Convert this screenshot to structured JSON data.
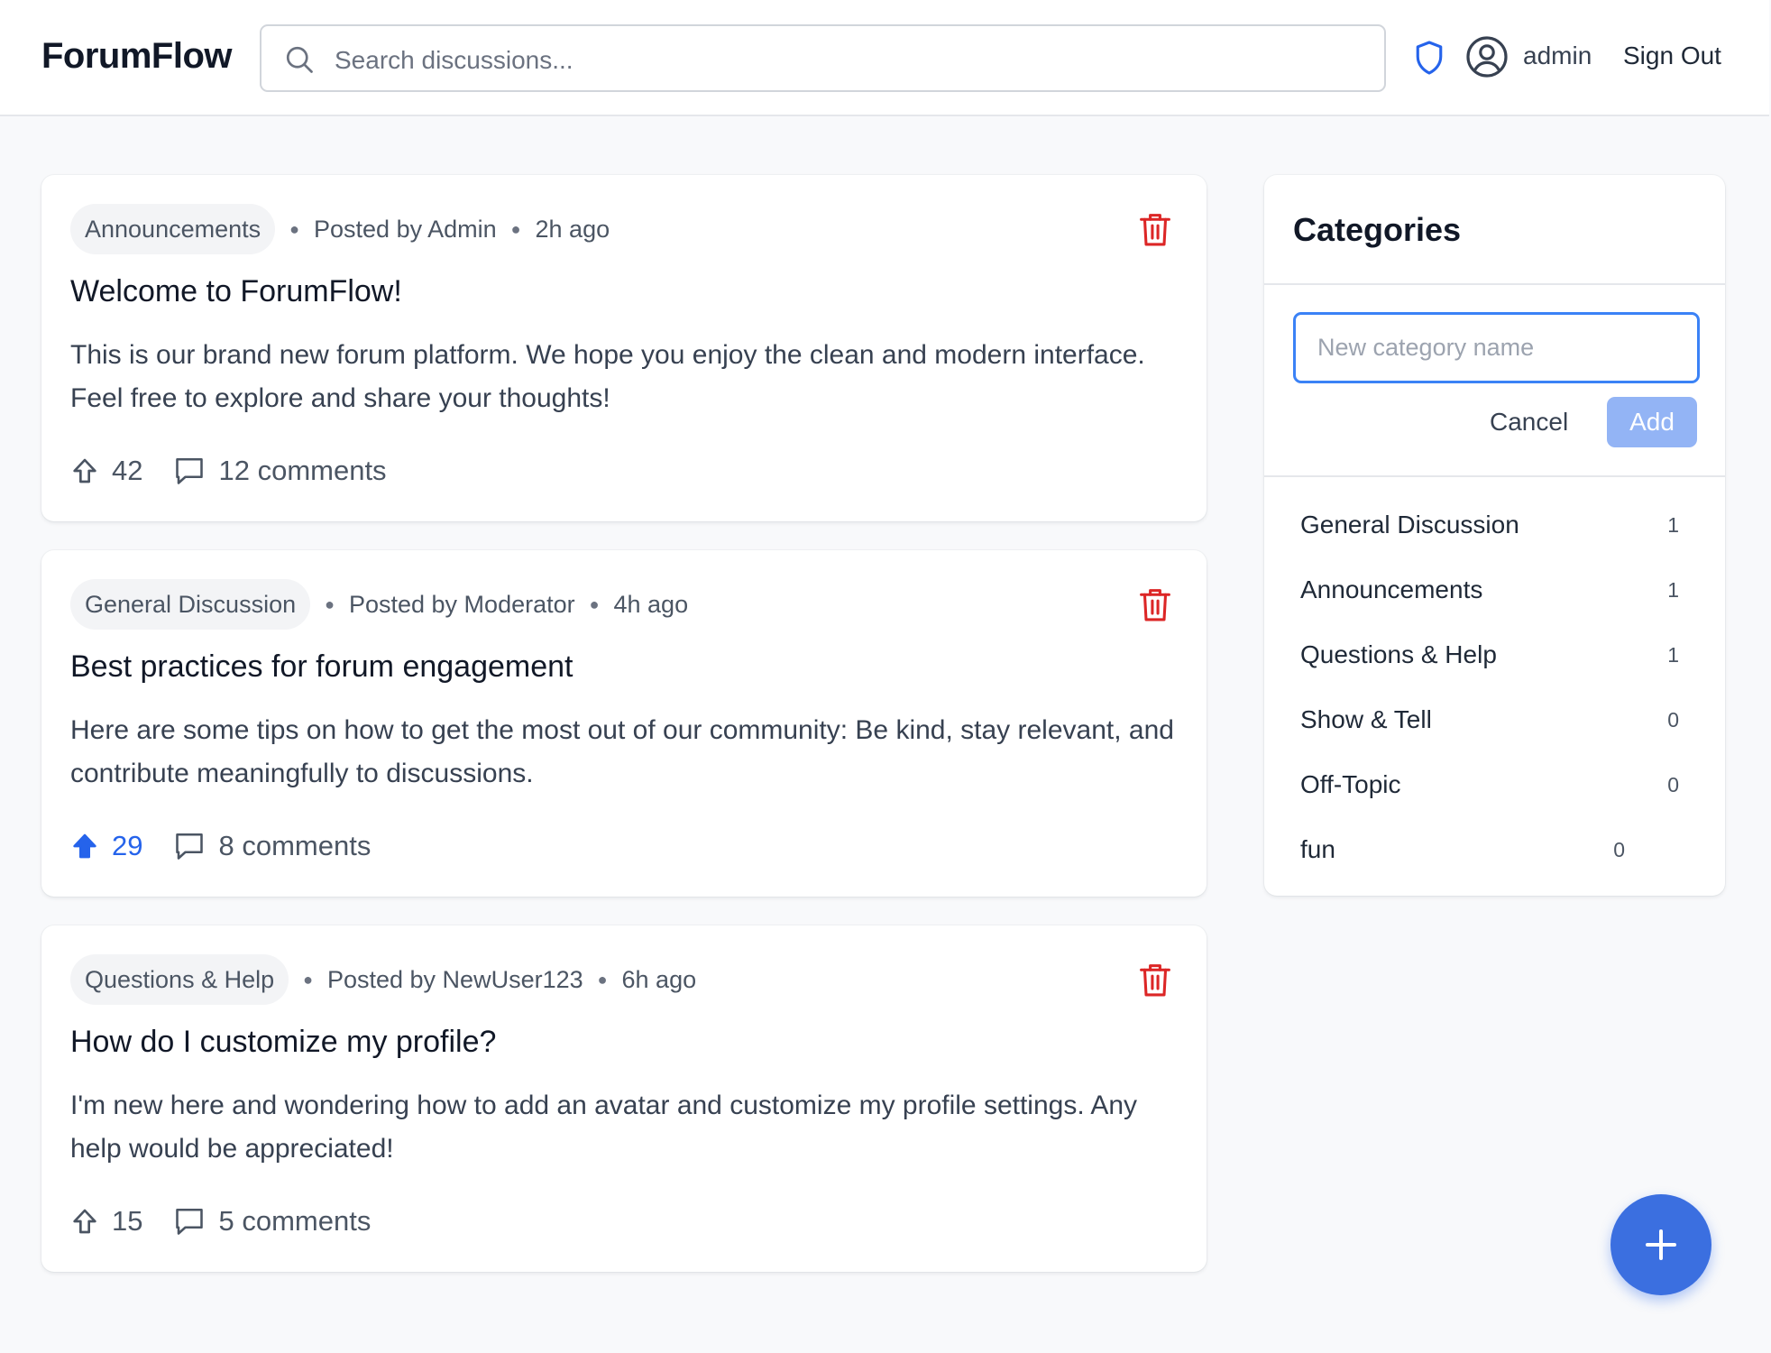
{
  "header": {
    "brand": "ForumFlow",
    "search_placeholder": "Search discussions...",
    "username": "admin",
    "sign_out": "Sign Out",
    "icons": [
      "search-icon",
      "shield-icon",
      "user-circle-icon"
    ]
  },
  "posts": [
    {
      "category": "Announcements",
      "author_text": "Posted by Admin",
      "time": "2h ago",
      "title": "Welcome to ForumFlow!",
      "body": "This is our brand new forum platform. We hope you enjoy the clean and modern interface. Feel free to explore and share your thoughts!",
      "votes": "42",
      "voted": false,
      "comments": "12 comments"
    },
    {
      "category": "General Discussion",
      "author_text": "Posted by Moderator",
      "time": "4h ago",
      "title": "Best practices for forum engagement",
      "body": "Here are some tips on how to get the most out of our community: Be kind, stay relevant, and contribute meaningfully to discussions.",
      "votes": "29",
      "voted": true,
      "comments": "8 comments"
    },
    {
      "category": "Questions & Help",
      "author_text": "Posted by NewUser123",
      "time": "6h ago",
      "title": "How do I customize my profile?",
      "body": "I'm new here and wondering how to add an avatar and customize my profile settings. Any help would be appreciated!",
      "votes": "15",
      "voted": false,
      "comments": "5 comments"
    }
  ],
  "sidebar": {
    "title": "Categories",
    "new_category_placeholder": "New category name",
    "new_category_value": "",
    "cancel_label": "Cancel",
    "add_label": "Add",
    "categories": [
      {
        "name": "General Discussion",
        "count": "1"
      },
      {
        "name": "Announcements",
        "count": "1"
      },
      {
        "name": "Questions & Help",
        "count": "1"
      },
      {
        "name": "Show & Tell",
        "count": "0"
      },
      {
        "name": "Off-Topic",
        "count": "0"
      },
      {
        "name": "fun",
        "count": "0"
      }
    ]
  },
  "fab": {
    "icon": "plus-icon"
  },
  "colors": {
    "accent": "#2563eb",
    "danger": "#dc2626",
    "background": "#f8f9fb",
    "add_button_disabled": "#93b4f5"
  }
}
